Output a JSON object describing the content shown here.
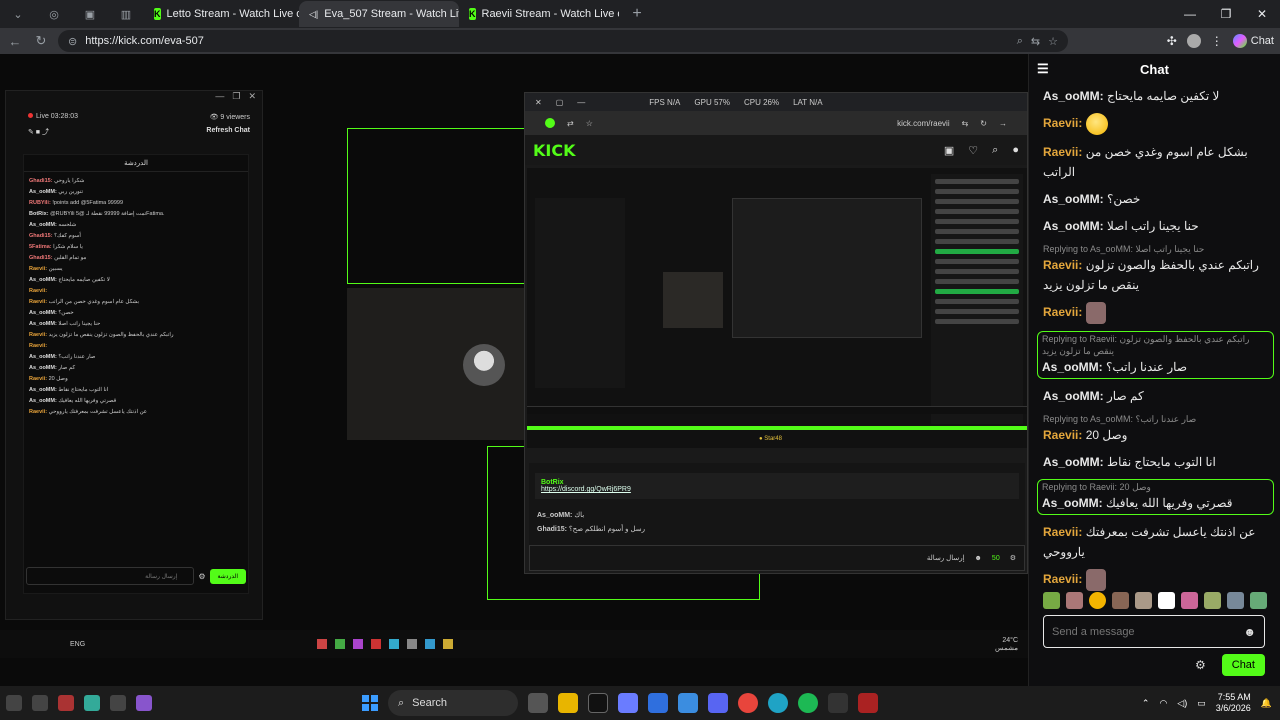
{
  "browser": {
    "tabs": [
      {
        "label": "Letto Stream - Watch Live on Kick"
      },
      {
        "label": "Eva_507 Stream - Watch Live"
      },
      {
        "label": "Raevii Stream - Watch Live on Kick"
      }
    ],
    "url": "https://kick.com/eva-507",
    "chat_button": "Chat"
  },
  "chat": {
    "title": "Chat",
    "messages": [
      {
        "user": "As_ooMM:",
        "text": "لا تكفين صايمه مايحتاج",
        "reply": ""
      },
      {
        "user": "Raevii:",
        "text": "",
        "reply": "",
        "emoji": "smile"
      },
      {
        "user": "Raevii:",
        "text": "بشكل عام اسوم وغدي خصن من الراتب",
        "reply": ""
      },
      {
        "user": "As_ooMM:",
        "text": "خصن؟",
        "reply": ""
      },
      {
        "user": "As_ooMM:",
        "text": "حنا يجينا راتب اصلا",
        "reply": ""
      },
      {
        "user": "Raevii:",
        "text": "راتبكم عندي بالحفظ والصون تزلون ينقص ما تزلون يزيد",
        "reply": "Replying to As_ooMM: حنا يجينا راتب اصلا"
      },
      {
        "user": "Raevii:",
        "text": "",
        "reply": "",
        "emoji": "emote"
      },
      {
        "user": "As_ooMM:",
        "text": "صار عندنا راتب؟",
        "reply": "Replying to Raevii: راتبكم عندي بالحفظ والصون تزلون ينقص ما تزلون يزيد",
        "highlight": true
      },
      {
        "user": "As_ooMM:",
        "text": "كم صار",
        "reply": ""
      },
      {
        "user": "Raevii:",
        "text": "وصل 20",
        "reply": "Replying to As_ooMM: صار عندنا راتب؟"
      },
      {
        "user": "As_ooMM:",
        "text": "انا التوب مايحتاج نقاط",
        "reply": ""
      },
      {
        "user": "As_ooMM:",
        "text": "قصرتي وفريها الله يعافيك",
        "reply": "Replying to Raevii: وصل 20",
        "highlight": true
      },
      {
        "user": "Raevii:",
        "text": "عن اذنتك ياعسل تشرفت بمعرفتك يارووحي",
        "reply": ""
      },
      {
        "user": "Raevii:",
        "text": "",
        "reply": "",
        "emoji": "emote"
      }
    ],
    "input_placeholder": "Send a message",
    "send_label": "Chat"
  },
  "inner_stream": {
    "live_time": "Live 03:28:03",
    "viewers": "9 viewers",
    "refresh_chat": "Refresh Chat",
    "chat_title": "الدردشة",
    "chat_send": "الدردشة",
    "chat_placeholder": "إرسال رسالة",
    "fps": "FPS N/A",
    "gpu": "GPU 57%",
    "cpu": "CPU 26%",
    "lat": "LAT N/A",
    "tab1": "Raevii Stream - Watch Live on",
    "tab2": "Eva_507 Stream - Watch Live on",
    "inner_url": "kick.com/raevii",
    "discord_link": "https://discord.gg/QwRj6PR9",
    "bot_name": "BotRix",
    "star": "Star48",
    "inner_chat_lines": [
      {
        "u": "Ghadi15:",
        "t": "شكرا ياروحي"
      },
      {
        "u": "As_ooMM:",
        "t": "تنورين ربي"
      },
      {
        "u": "RUBYili:",
        "t": "!points add @5Fatima 99999"
      },
      {
        "u": "BotRix:",
        "t": "@RUBYili تمت إضافة 99999 نقطة لـ @5Fatima."
      },
      {
        "u": "As_ooMM:",
        "t": "شلحسه"
      },
      {
        "u": "Ghadi15:",
        "t": "أسوم كفك؟"
      },
      {
        "u": "5Fatima:",
        "t": "يا سلام شكرا"
      },
      {
        "u": "Ghadi15:",
        "t": "مو تمام القلبن"
      },
      {
        "u": "Raevii:",
        "t": "يسبين"
      },
      {
        "u": "As_ooMM:",
        "t": "لا تكفين صايمه مايحتاج"
      },
      {
        "u": "Raevii:",
        "t": ""
      },
      {
        "u": "Raevii:",
        "t": "بشكل عام اسوم وغدي خصن من الراتب"
      },
      {
        "u": "As_ooMM:",
        "t": "خصن؟"
      },
      {
        "u": "As_ooMM:",
        "t": "حنا يجينا راتب اصلا"
      },
      {
        "u": "Raevii:",
        "t": "راتبكم عندي بالحفظ والصون تزلون ينقص ما تزلون يزيد"
      },
      {
        "u": "Raevii:",
        "t": ""
      },
      {
        "u": "As_ooMM:",
        "t": "صار عندنا راتب؟"
      },
      {
        "u": "As_ooMM:",
        "t": "كم صار"
      },
      {
        "u": "Raevii:",
        "t": "وصل 20"
      },
      {
        "u": "As_ooMM:",
        "t": "انا التوب مايحتاج نقاط"
      },
      {
        "u": "As_ooMM:",
        "t": "قصرتي وفريها الله يعافيك"
      },
      {
        "u": "Raevii:",
        "t": "عن اذنتك ياعسل تشرفت بمعرفتك يارووحي"
      }
    ],
    "bottom_lines": [
      {
        "u": "As_ooMM:",
        "t": "باك"
      },
      {
        "u": "Ghadi15:",
        "t": "رسل و أسوم انطلكم صح؟"
      }
    ],
    "count": "50",
    "language": "ENG",
    "weather": "24°C",
    "weather_desc": "مشمس"
  },
  "taskbar": {
    "search": "Search",
    "time": "7:55 AM",
    "date": "3/6/2026"
  },
  "colors": {
    "kick_green": "#53fc18",
    "raevii": "#e3a63c"
  }
}
